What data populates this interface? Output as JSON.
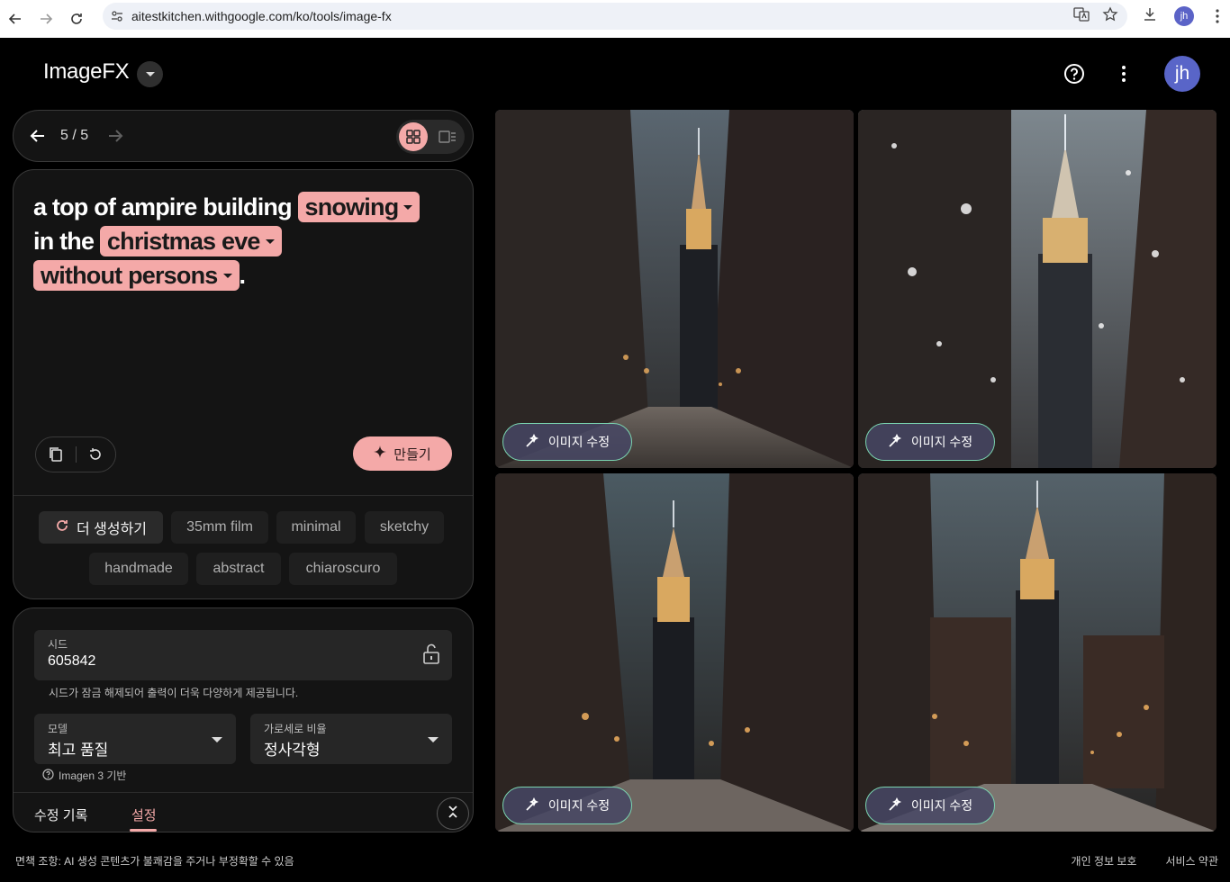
{
  "browser": {
    "url": "aitestkitchen.withgoogle.com/ko/tools/image-fx",
    "profile_initials": "jh"
  },
  "app": {
    "title": "ImageFX",
    "user_initials": "jh"
  },
  "pager": {
    "count": "5 / 5"
  },
  "prompt": {
    "text_1": "a top of ampire building",
    "chip_1": "snowing",
    "text_2": "in the",
    "chip_2": "christmas eve",
    "chip_3": "without persons",
    "text_3": "."
  },
  "actions": {
    "make_label": "만들기"
  },
  "suggestions": {
    "more_label": "더 생성하기",
    "items": [
      "35mm film",
      "minimal",
      "sketchy",
      "handmade",
      "abstract",
      "chiaroscuro"
    ]
  },
  "settings": {
    "seed_label": "시드",
    "seed_value": "605842",
    "seed_hint": "시드가 잠금 해제되어 출력이 더욱 다양하게 제공됩니다.",
    "model_label": "모델",
    "model_value": "최고 품질",
    "ratio_label": "가로세로 비율",
    "ratio_value": "정사각형",
    "imagen_note": "Imagen 3 기반",
    "tab_history": "수정 기록",
    "tab_settings": "설정"
  },
  "images": {
    "edit_label": "이미지 수정"
  },
  "footer": {
    "disclaimer": "면책 조항: AI 생성 콘텐츠가 불쾌감을 주거나 부정확할 수 있음",
    "privacy": "개인 정보 보호",
    "terms": "서비스 약관"
  },
  "colors": {
    "accent": "#f4a9a8",
    "background": "#000000",
    "card": "#141414",
    "avatar": "#5965c8"
  }
}
